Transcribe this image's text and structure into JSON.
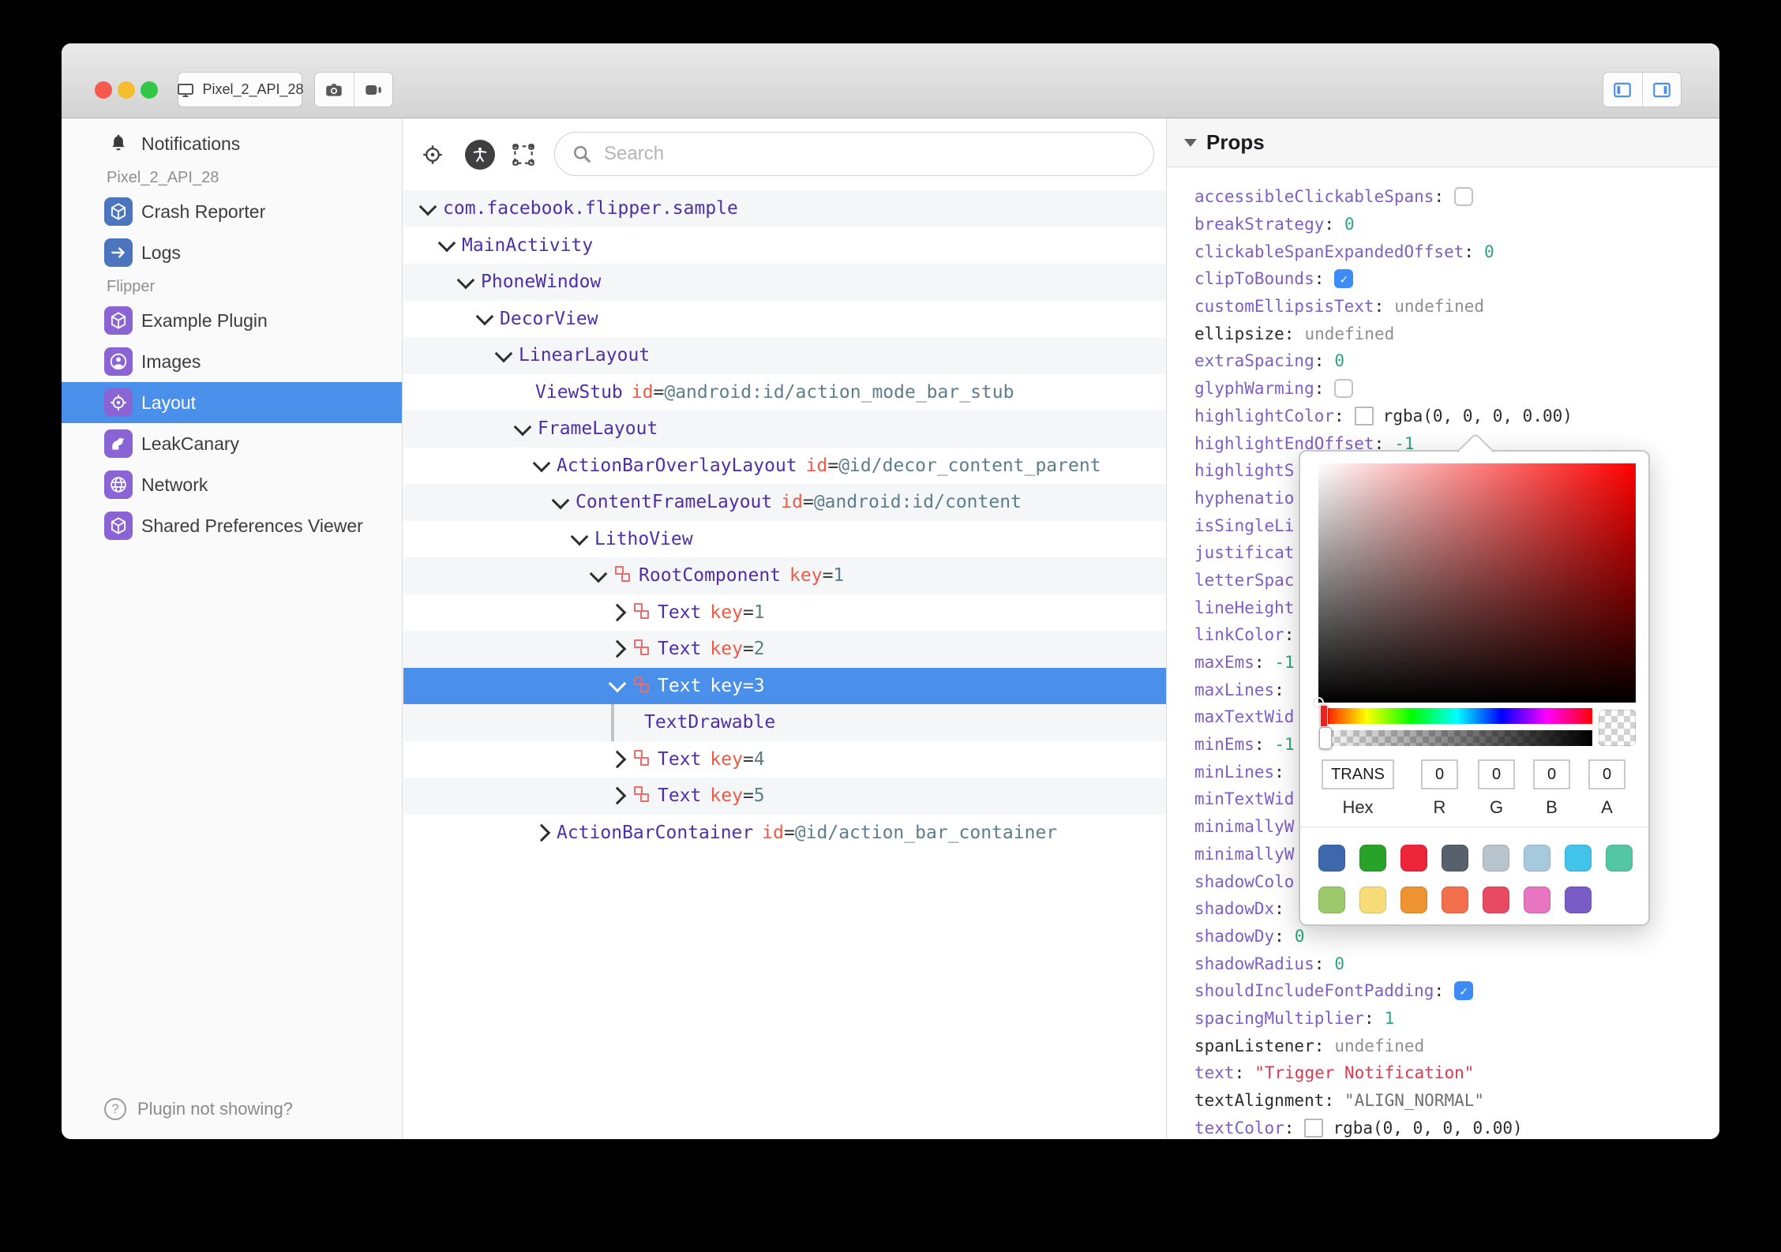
{
  "titlebar": {
    "device": "Pixel_2_API_28",
    "traffic_colors": {
      "close": "#f6594e",
      "minimize": "#f5bd2e",
      "zoom": "#33c748"
    },
    "accent": "#4a8fe9"
  },
  "sidebar": {
    "top_item": {
      "label": "Notifications",
      "icon": "bell"
    },
    "sections": [
      {
        "header": "Pixel_2_API_28",
        "items": [
          {
            "label": "Crash Reporter",
            "icon": "cube",
            "color": "#4b76bd"
          },
          {
            "label": "Logs",
            "icon": "arrow",
            "color": "#4b76bd"
          }
        ]
      },
      {
        "header": "Flipper",
        "items": [
          {
            "label": "Example Plugin",
            "icon": "cube",
            "color": "#8a63d4"
          },
          {
            "label": "Images",
            "icon": "person",
            "color": "#8a63d4"
          },
          {
            "label": "Layout",
            "icon": "target",
            "color": "#8a63d4",
            "selected": true
          },
          {
            "label": "LeakCanary",
            "icon": "bird",
            "color": "#8a63d4"
          },
          {
            "label": "Network",
            "icon": "globe",
            "color": "#8a63d4"
          },
          {
            "label": "Shared Preferences Viewer",
            "icon": "cube",
            "color": "#8a63d4"
          }
        ]
      }
    ],
    "footer": "Plugin not showing?"
  },
  "toolbar": {
    "search_placeholder": "Search"
  },
  "tree": {
    "colors": {
      "name": "#4f2fa8",
      "attr_name": "#ee5a45",
      "attr_value": "#5c7e8c",
      "selected_bg": "#4a8fe9",
      "litho_icon": "#f16a6a"
    },
    "rows": [
      {
        "level": 0,
        "ch": "d",
        "name": "com.facebook.flipper.sample"
      },
      {
        "level": 1,
        "ch": "d",
        "name": "MainActivity"
      },
      {
        "level": 2,
        "ch": "d",
        "name": "PhoneWindow"
      },
      {
        "level": 3,
        "ch": "d",
        "name": "DecorView"
      },
      {
        "level": 4,
        "ch": "d",
        "name": "LinearLayout"
      },
      {
        "level": 5,
        "ch": "",
        "name": "ViewStub",
        "attrs": [
          {
            "n": "id",
            "v": "@android:id/action_mode_bar_stub"
          }
        ]
      },
      {
        "level": 5,
        "ch": "d",
        "name": "FrameLayout"
      },
      {
        "level": 6,
        "ch": "d",
        "name": "ActionBarOverlayLayout",
        "attrs": [
          {
            "n": "id",
            "v": "@id/decor_content_parent"
          }
        ]
      },
      {
        "level": 7,
        "ch": "d",
        "name": "ContentFrameLayout",
        "attrs": [
          {
            "n": "id",
            "v": "@android:id/content"
          }
        ]
      },
      {
        "level": 8,
        "ch": "d",
        "name": "LithoView"
      },
      {
        "level": 9,
        "ch": "d",
        "litho": true,
        "name": "RootComponent",
        "attrs": [
          {
            "n": "key",
            "v": "1"
          }
        ]
      },
      {
        "level": 10,
        "ch": "r",
        "litho": true,
        "name": "Text",
        "attrs": [
          {
            "n": "key",
            "v": "1"
          }
        ]
      },
      {
        "level": 10,
        "ch": "r",
        "litho": true,
        "name": "Text",
        "attrs": [
          {
            "n": "key",
            "v": "2"
          }
        ]
      },
      {
        "level": 10,
        "ch": "d",
        "litho": true,
        "name": "Text",
        "attrs": [
          {
            "n": "key",
            "v": "3"
          }
        ],
        "selected": true
      },
      {
        "level": 11,
        "guide": true,
        "name": "TextDrawable"
      },
      {
        "level": 10,
        "ch": "r",
        "litho": true,
        "name": "Text",
        "attrs": [
          {
            "n": "key",
            "v": "4"
          }
        ]
      },
      {
        "level": 10,
        "ch": "r",
        "litho": true,
        "name": "Text",
        "attrs": [
          {
            "n": "key",
            "v": "5"
          }
        ]
      },
      {
        "level": 6,
        "ch": "r",
        "name": "ActionBarContainer",
        "attrs": [
          {
            "n": "id",
            "v": "@id/action_bar_container"
          }
        ]
      }
    ]
  },
  "props": {
    "title": "Props",
    "rows": [
      {
        "label": "accessibleClickableSpans",
        "colon": true,
        "style": "purple",
        "value": {
          "type": "check_off"
        }
      },
      {
        "label": "breakStrategy",
        "colon": true,
        "style": "purple",
        "value": {
          "type": "num",
          "text": "0"
        }
      },
      {
        "label": "clickableSpanExpandedOffset",
        "colon": true,
        "style": "purple",
        "value": {
          "type": "num",
          "text": "0"
        }
      },
      {
        "label": "clipToBounds",
        "colon": true,
        "style": "purple",
        "value": {
          "type": "check_on"
        }
      },
      {
        "label": "customEllipsisText",
        "colon": true,
        "style": "purple",
        "value": {
          "type": "undef",
          "text": "undefined"
        }
      },
      {
        "label": "ellipsize",
        "colon": true,
        "style": "black",
        "value": {
          "type": "undef",
          "text": "undefined"
        }
      },
      {
        "label": "extraSpacing",
        "colon": true,
        "style": "purple",
        "value": {
          "type": "num",
          "text": "0"
        }
      },
      {
        "label": "glyphWarming",
        "colon": true,
        "style": "purple",
        "value": {
          "type": "check_off"
        }
      },
      {
        "label": "highlightColor",
        "colon": true,
        "style": "purple",
        "value": {
          "type": "color",
          "text": "rgba(0, 0, 0, 0.00)"
        }
      },
      {
        "label": "highlightEndOffset",
        "colon": true,
        "style": "purple",
        "value": {
          "type": "num",
          "text": "-1"
        }
      },
      {
        "label": "highlightS",
        "colon": false,
        "style": "purple",
        "value": {
          "type": "none"
        }
      },
      {
        "label": "hyphenatio",
        "colon": false,
        "style": "purple",
        "value": {
          "type": "none"
        }
      },
      {
        "label": "isSingleLi",
        "colon": false,
        "style": "purple",
        "value": {
          "type": "none"
        }
      },
      {
        "label": "justificat",
        "colon": false,
        "style": "purple",
        "value": {
          "type": "none"
        }
      },
      {
        "label": "letterSpac",
        "colon": false,
        "style": "purple",
        "value": {
          "type": "none"
        }
      },
      {
        "label": "lineHeight",
        "colon": false,
        "style": "purple",
        "value": {
          "type": "none"
        }
      },
      {
        "label": "linkColor",
        "colon": true,
        "style": "purple",
        "value": {
          "type": "none"
        }
      },
      {
        "label": "maxEms",
        "colon": true,
        "style": "purple",
        "value": {
          "type": "num",
          "text": "-1"
        }
      },
      {
        "label": "maxLines",
        "colon": true,
        "style": "purple",
        "value": {
          "type": "none"
        }
      },
      {
        "label": "maxTextWid",
        "colon": false,
        "style": "purple",
        "value": {
          "type": "none"
        }
      },
      {
        "label": "minEms",
        "colon": true,
        "style": "purple",
        "value": {
          "type": "num",
          "text": "-1"
        }
      },
      {
        "label": "minLines",
        "colon": true,
        "style": "purple",
        "value": {
          "type": "none"
        }
      },
      {
        "label": "minTextWid",
        "colon": false,
        "style": "purple",
        "value": {
          "type": "none"
        }
      },
      {
        "label": "minimallyW",
        "colon": false,
        "style": "purple",
        "value": {
          "type": "none"
        }
      },
      {
        "label": "minimallyW",
        "colon": false,
        "style": "purple",
        "value": {
          "type": "none"
        }
      },
      {
        "label": "shadowColo",
        "colon": false,
        "style": "purple",
        "value": {
          "type": "none"
        }
      },
      {
        "label": "shadowDx",
        "colon": true,
        "style": "purple",
        "value": {
          "type": "none"
        }
      },
      {
        "label": "shadowDy",
        "colon": true,
        "style": "purple",
        "value": {
          "type": "num",
          "text": "0"
        }
      },
      {
        "label": "shadowRadius",
        "colon": true,
        "style": "purple",
        "value": {
          "type": "num",
          "text": "0"
        }
      },
      {
        "label": "shouldIncludeFontPadding",
        "colon": true,
        "style": "purple",
        "value": {
          "type": "check_on"
        }
      },
      {
        "label": "spacingMultiplier",
        "colon": true,
        "style": "purple",
        "value": {
          "type": "num",
          "text": "1"
        }
      },
      {
        "label": "spanListener",
        "colon": true,
        "style": "black",
        "value": {
          "type": "undef",
          "text": "undefined"
        }
      },
      {
        "label": "text",
        "colon": true,
        "style": "purple",
        "value": {
          "type": "str_red",
          "text": "\"Trigger Notification\""
        }
      },
      {
        "label": "textAlignment",
        "colon": true,
        "style": "black",
        "value": {
          "type": "str_gray",
          "text": "\"ALIGN_NORMAL\""
        }
      },
      {
        "label": "textColor",
        "colon": true,
        "style": "purple",
        "value": {
          "type": "color",
          "text": "rgba(0, 0, 0, 0.00)"
        }
      }
    ]
  },
  "picker": {
    "hex": "TRANS",
    "r": "0",
    "g": "0",
    "b": "0",
    "a": "0",
    "labels": {
      "hex": "Hex",
      "r": "R",
      "g": "G",
      "b": "B",
      "a": "A"
    },
    "swatch_rows": [
      [
        "#3e68ad",
        "#28a228",
        "#ee2438",
        "#57606c",
        "#b7c4cd",
        "#a6c9dd",
        "#41c3ea",
        "#55c6a3"
      ],
      [
        "#9bc96b",
        "#f8dc7a",
        "#ee9331",
        "#f2704b",
        "#e84a61",
        "#e875c2",
        "#7a5cc6"
      ]
    ]
  }
}
